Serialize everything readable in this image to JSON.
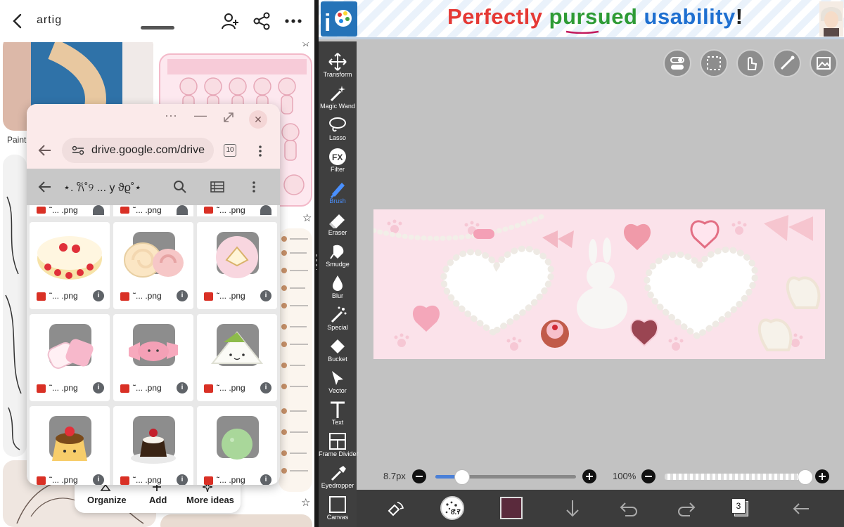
{
  "pinterest": {
    "board_title": "artig",
    "pin_label": "Paint",
    "bottom_menu": {
      "organize": "Organize",
      "add": "Add",
      "more_ideas": "More ideas"
    }
  },
  "browser": {
    "url": "drive.google.com/drive",
    "tab_count": "10",
    "folder_name": "⋆. 𐙚˚୨ ... y ϑϱ˚⋆",
    "file_label": "˜๜... .png",
    "top_row_label": "˜... .png",
    "files": [
      {
        "label": "˜๜... .png",
        "icon": "cake-roll-icon"
      },
      {
        "label": "˜๜... .png",
        "icon": "swiss-roll-icon"
      },
      {
        "label": "˜๜... .png",
        "icon": "cookie-plate-icon"
      },
      {
        "label": "˜๜... .png",
        "icon": "marshmallow-icon"
      },
      {
        "label": "˜๜... .png",
        "icon": "candy-icon"
      },
      {
        "label": "˜๜... .png",
        "icon": "sandwich-icon"
      },
      {
        "label": "˜๜... .png",
        "icon": "pudding-icon"
      },
      {
        "label": "˜๜... .png",
        "icon": "chocolate-pudding-icon"
      },
      {
        "label": "˜๜... .png",
        "icon": "icecream-icon"
      }
    ]
  },
  "ibis": {
    "ad": {
      "w1": "Perfectly",
      "w2": "pursued",
      "w3": "usability",
      "w4": "!"
    },
    "tools": [
      {
        "label": "Transform",
        "icon": "move-icon"
      },
      {
        "label": "Magic Wand",
        "icon": "magic-wand-icon"
      },
      {
        "label": "Lasso",
        "icon": "lasso-icon"
      },
      {
        "label": "Filter",
        "icon": "fx-icon"
      },
      {
        "label": "Brush",
        "icon": "brush-icon"
      },
      {
        "label": "Eraser",
        "icon": "eraser-icon"
      },
      {
        "label": "Smudge",
        "icon": "smudge-icon"
      },
      {
        "label": "Blur",
        "icon": "blur-icon"
      },
      {
        "label": "Special",
        "icon": "special-icon"
      },
      {
        "label": "Bucket",
        "icon": "bucket-icon"
      },
      {
        "label": "Vector",
        "icon": "vector-icon"
      },
      {
        "label": "Text",
        "icon": "text-icon"
      },
      {
        "label": "Frame Divider",
        "icon": "frame-divider-icon"
      },
      {
        "label": "Eyedropper",
        "icon": "eyedropper-icon"
      },
      {
        "label": "Canvas",
        "icon": "canvas-icon"
      }
    ],
    "active_tool": "Brush",
    "brush_size": "8.7px",
    "brush_size_fraction": 0.19,
    "opacity": "100%",
    "opacity_fraction": 1.0,
    "brush_badge": "8.7",
    "layer_count": "3",
    "color": "#5a2a3c",
    "accent": "#4a90ff"
  }
}
